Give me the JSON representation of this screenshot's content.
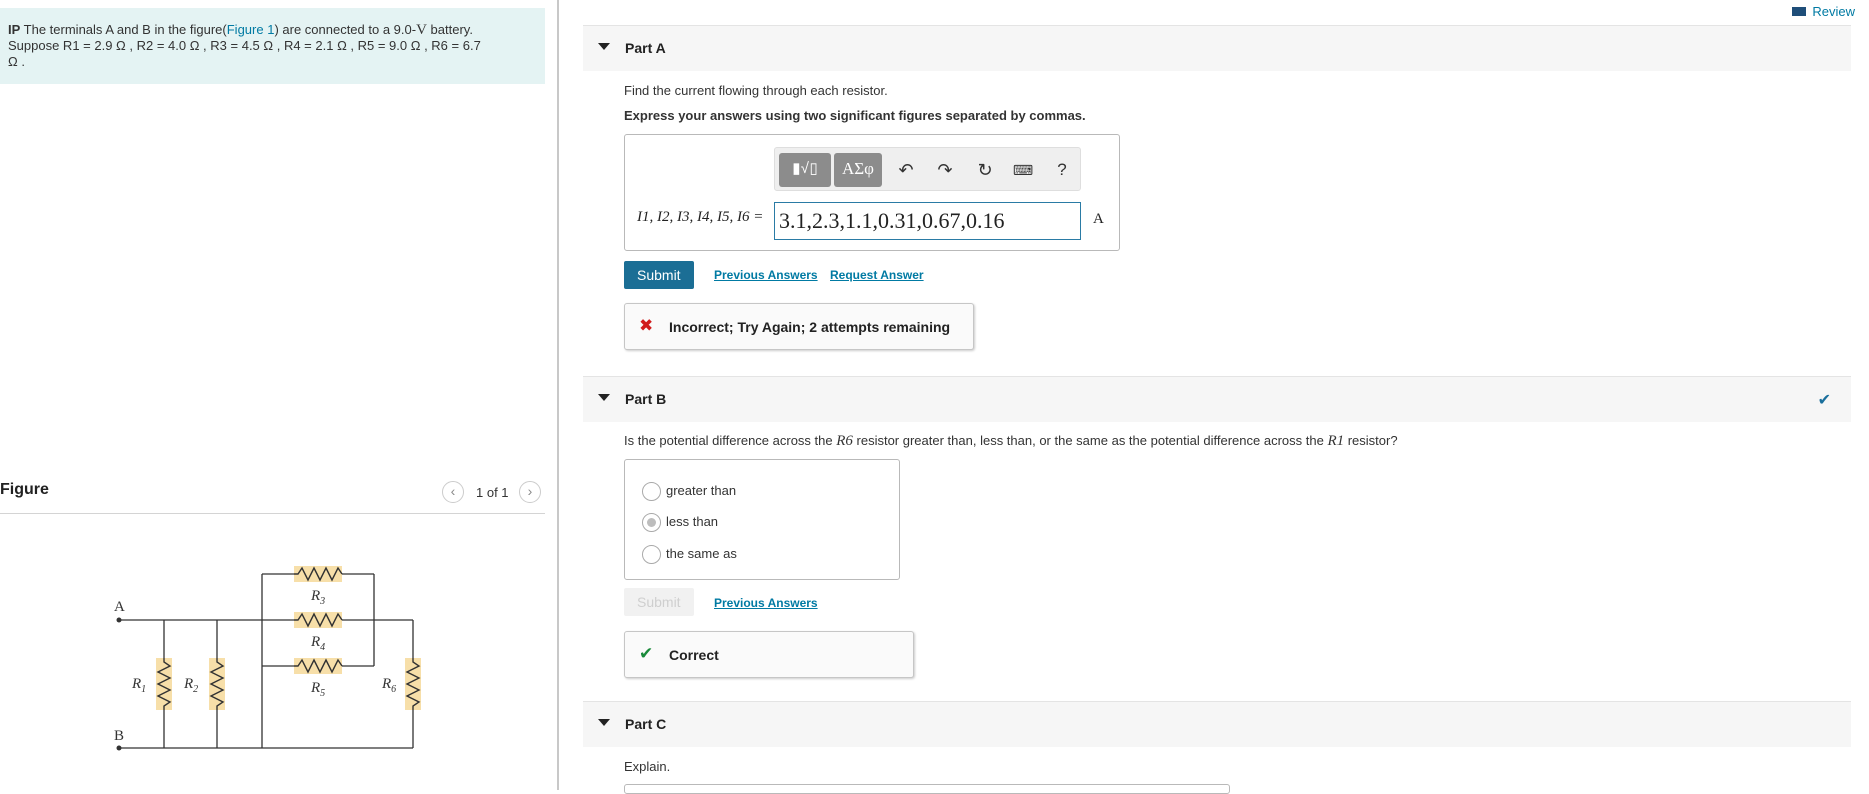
{
  "problem": {
    "ip": "IP",
    "text1": " The terminals A and B in the figure(",
    "figure_link": "Figure 1",
    "text2": ") are connected to a 9.0-",
    "voltage_unit": "V",
    "text3": " battery.",
    "line2": "Suppose R1 = 2.9 Ω , R2 = 4.0 Ω , R3 = 4.5 Ω , R4 = 2.1 Ω , R5 = 9.0 Ω , R6 = 6.7",
    "line3": "Ω ."
  },
  "figure": {
    "title": "Figure",
    "pager": "1 of 1",
    "node_a": "A",
    "node_b": "B",
    "labels": {
      "r1": "R",
      "r2": "R",
      "r3": "R",
      "r4": "R",
      "r5": "R",
      "r6": "R"
    },
    "subs": {
      "r1": "1",
      "r2": "2",
      "r3": "3",
      "r4": "4",
      "r5": "5",
      "r6": "6"
    }
  },
  "header": {
    "review": "Review"
  },
  "partA": {
    "title": "Part A",
    "instruction": "Find the current flowing through each resistor.",
    "format": "Express your answers using two significant figures separated by commas.",
    "toolbar": {
      "symbols": "ΑΣφ",
      "help": "?"
    },
    "equation_label": "I1, I2, I3, I4, I5, I6 =",
    "answer_value": "3.1,2.3,1.1,0.31,0.67,0.16",
    "unit": "A",
    "submit": "Submit",
    "previous_answers": "Previous Answers",
    "request_answer": "Request Answer",
    "feedback": "Incorrect; Try Again; 2 attempts remaining"
  },
  "partB": {
    "title": "Part B",
    "question_pre": "Is the potential difference across the ",
    "question_mid": " resistor greater than, less than, or the same as the potential difference across the ",
    "question_post": " resistor?",
    "r6": "R6",
    "r1": "R1",
    "choices": [
      "greater than",
      "less than",
      "the same as"
    ],
    "selected_index": 1,
    "submit": "Submit",
    "previous_answers": "Previous Answers",
    "feedback": "Correct"
  },
  "partC": {
    "title": "Part C",
    "instruction": "Explain."
  },
  "colors": {
    "accent": "#007aa3",
    "submit_bg": "#1b6e95",
    "incorrect": "#d11b1b",
    "correct": "#1a8a3a",
    "problem_bg": "#e4f3f3"
  }
}
